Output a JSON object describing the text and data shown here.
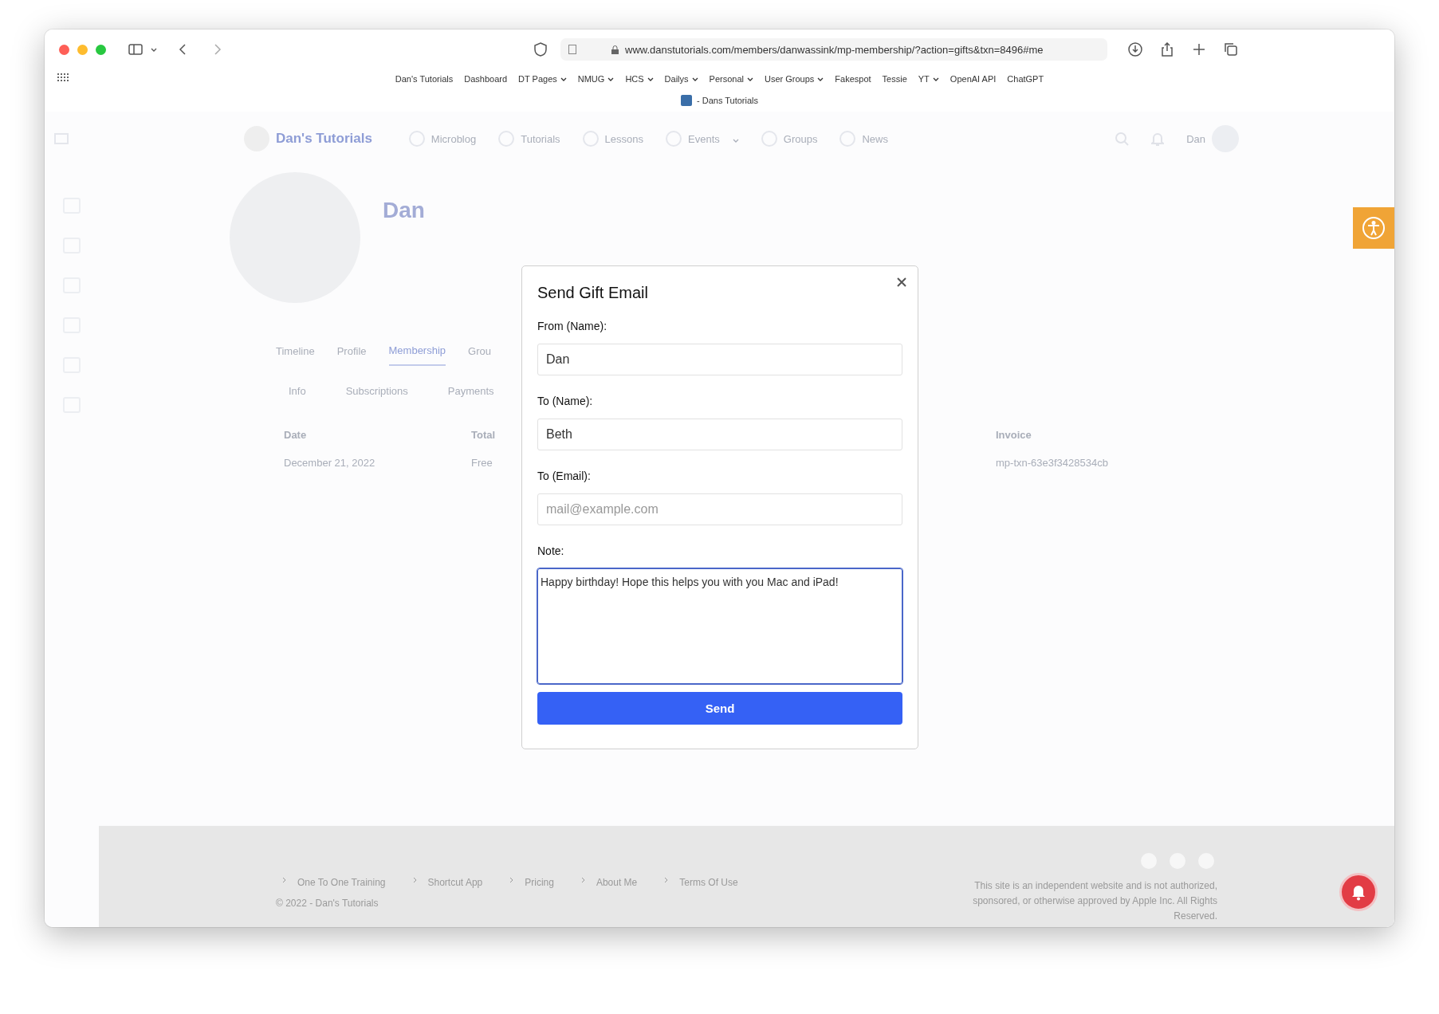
{
  "browser": {
    "url": "www.danstutorials.com/members/danwassink/mp-membership/?action=gifts&txn=8496#me",
    "bookmarks": [
      {
        "label": "Dan's Tutorials",
        "menu": false
      },
      {
        "label": "Dashboard",
        "menu": false
      },
      {
        "label": "DT Pages",
        "menu": true
      },
      {
        "label": "NMUG",
        "menu": true
      },
      {
        "label": "HCS",
        "menu": true
      },
      {
        "label": "Dailys",
        "menu": true
      },
      {
        "label": "Personal",
        "menu": true
      },
      {
        "label": "User Groups",
        "menu": true
      },
      {
        "label": "Fakespot",
        "menu": false
      },
      {
        "label": "Tessie",
        "menu": false
      },
      {
        "label": "YT",
        "menu": true
      },
      {
        "label": "OpenAI API",
        "menu": false
      },
      {
        "label": "ChatGPT",
        "menu": false
      }
    ],
    "tab_title": "- Dans Tutorials"
  },
  "site": {
    "logo_text": "Dan's Tutorials",
    "nav": [
      {
        "label": "Microblog",
        "menu": false
      },
      {
        "label": "Tutorials",
        "menu": false
      },
      {
        "label": "Lessons",
        "menu": false
      },
      {
        "label": "Events",
        "menu": true
      },
      {
        "label": "Groups",
        "menu": false
      },
      {
        "label": "News",
        "menu": false
      }
    ],
    "user_name": "Dan"
  },
  "profile": {
    "name": "Dan",
    "tabs": [
      {
        "label": "Timeline",
        "selected": false
      },
      {
        "label": "Profile",
        "selected": false
      },
      {
        "label": "Membership",
        "selected": true
      },
      {
        "label": "Grou",
        "selected": false
      }
    ],
    "subtabs": [
      {
        "label": "Info"
      },
      {
        "label": "Subscriptions"
      },
      {
        "label": "Payments"
      }
    ],
    "table": {
      "columns": [
        "Date",
        "Total",
        "Invoice"
      ],
      "rows": [
        [
          "December 21, 2022",
          "Free",
          "mp-txn-63e3f3428534cb"
        ]
      ]
    }
  },
  "modal": {
    "title": "Send Gift Email",
    "fields": [
      {
        "label": "From (Name):",
        "kind": "input",
        "value": "Dan",
        "focused": false
      },
      {
        "label": "To (Name):",
        "kind": "input",
        "value": "Beth",
        "focused": false
      },
      {
        "label": "To (Email):",
        "kind": "input",
        "placeholder": "mail@example.com",
        "focused": false
      },
      {
        "label": "Note:",
        "kind": "textarea",
        "value": "Happy birthday! Hope this helps you with you Mac and iPad!",
        "focused": true
      }
    ],
    "button": "Send"
  },
  "footer": {
    "links": [
      "One To One Training",
      "Shortcut App",
      "Pricing",
      "About Me",
      "Terms Of Use"
    ],
    "copyright": "© 2022 - Dan's Tutorials",
    "disclaimer": "This site is an independent website and is not authorized, sponsored, or otherwise approved by Apple Inc. All Rights Reserved."
  }
}
